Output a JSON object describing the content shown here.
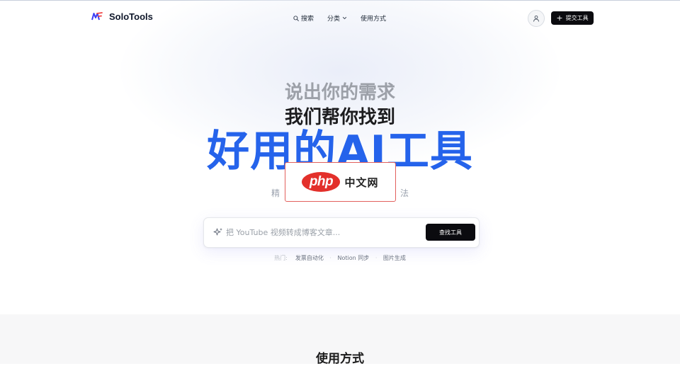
{
  "header": {
    "brand": "SoloTools",
    "nav": [
      {
        "label": "搜索",
        "icon": "search-icon"
      },
      {
        "label": "分类",
        "icon": "chevron-down-icon"
      },
      {
        "label": "使用方式"
      }
    ],
    "user_icon": "user-icon",
    "submit_label": "提交工具"
  },
  "hero": {
    "line1": "说出你的需求",
    "line2": "我们帮你找到",
    "line3": "好用的AI工具",
    "subtitle_left": "精",
    "subtitle_right": "法"
  },
  "watermark": {
    "logo": "php",
    "text": "中文网"
  },
  "search": {
    "placeholder": "把 YouTube 视频转成博客文章...",
    "value": "",
    "button": "查找工具"
  },
  "hot": {
    "label": "热门:",
    "tags": [
      "发票自动化",
      "Notion 同步",
      "图片生成"
    ]
  },
  "section2": {
    "title": "使用方式"
  },
  "colors": {
    "accent": "#2563eb",
    "button_bg": "#0b0b0f",
    "watermark_red": "#e3302b"
  }
}
